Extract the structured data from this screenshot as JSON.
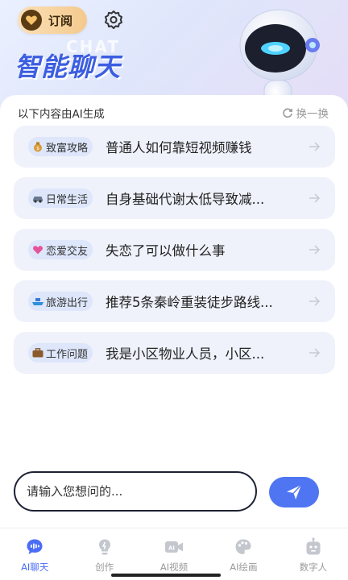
{
  "header": {
    "subscribe_label": "订阅",
    "watermark": "CHAT",
    "title": "智能聊天"
  },
  "card": {
    "note": "以下内容由AI生成",
    "refresh_label": "换一换"
  },
  "prompts": [
    {
      "tag": "致富攻略",
      "icon": "money-bag-icon",
      "text": "普通人如何靠短视频赚钱"
    },
    {
      "tag": "日常生活",
      "icon": "car-icon",
      "text": "自身基础代谢太低导致减..."
    },
    {
      "tag": "恋爱交友",
      "icon": "heart-icon",
      "text": "失恋了可以做什么事"
    },
    {
      "tag": "旅游出行",
      "icon": "cruise-ship-icon",
      "text": "推荐5条秦岭重装徒步路线..."
    },
    {
      "tag": "工作问题",
      "icon": "briefcase-icon",
      "text": "我是小区物业人员，小区..."
    }
  ],
  "input": {
    "placeholder": "请输入您想问的...",
    "value": ""
  },
  "tabs": [
    {
      "label": "AI聊天",
      "icon": "chat-bubble-icon",
      "active": true
    },
    {
      "label": "创作",
      "icon": "lightbulb-icon",
      "active": false
    },
    {
      "label": "AI视频",
      "icon": "video-camera-icon",
      "active": false
    },
    {
      "label": "AI绘画",
      "icon": "palette-icon",
      "active": false
    },
    {
      "label": "数字人",
      "icon": "robot-icon",
      "active": false
    }
  ],
  "colors": {
    "accent": "#4f75f2",
    "title": "#3c5ee0",
    "item_bg": "#eff2fb",
    "tag_bg": "#dde6fa"
  }
}
